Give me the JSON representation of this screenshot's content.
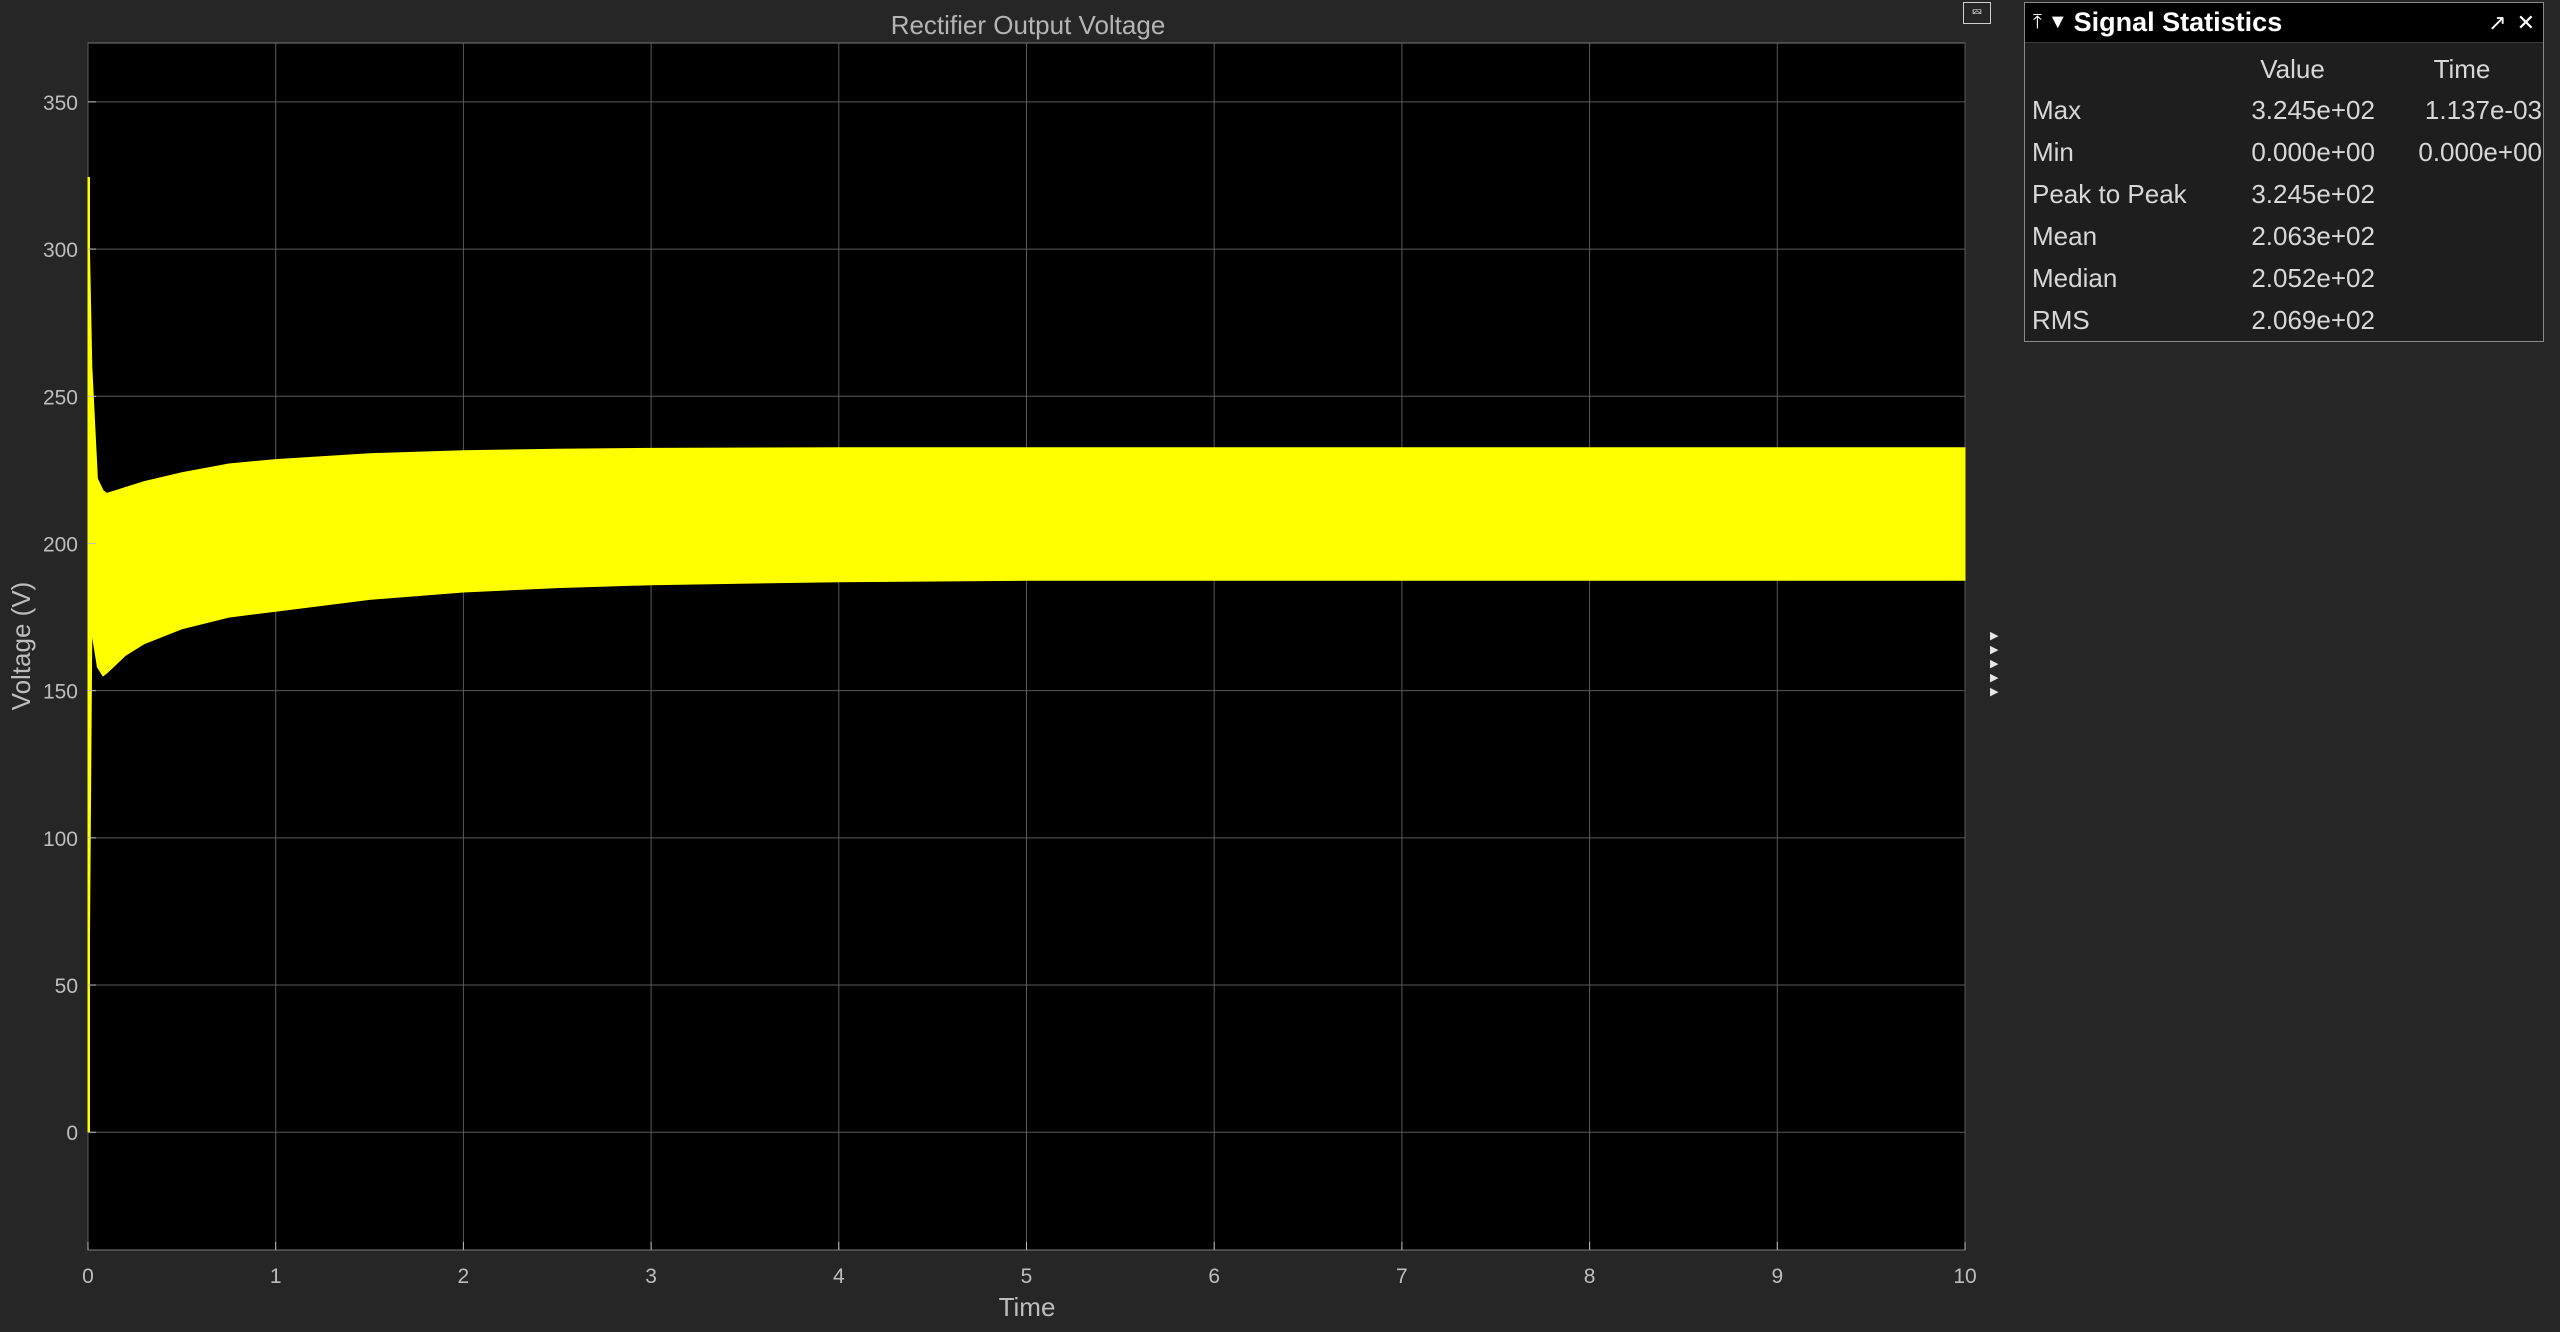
{
  "scope": {
    "colors": {
      "background": "#262626",
      "plot_background": "#000000",
      "grid": "#5a5a5a",
      "signal": "#ffff00",
      "text": "#bdbdbd"
    },
    "undock_icon": "undock-icon"
  },
  "chart_data": {
    "type": "line",
    "title": "Rectifier Output Voltage",
    "xlabel": "Time",
    "ylabel": "Voltage (V)",
    "xlim": [
      0,
      10
    ],
    "ylim": [
      -40,
      370
    ],
    "x_ticks": [
      0,
      1,
      2,
      3,
      4,
      5,
      6,
      7,
      8,
      9,
      10
    ],
    "y_ticks": [
      0,
      50,
      100,
      150,
      200,
      250,
      300,
      350
    ],
    "x_tick_labels": [
      "0",
      "1",
      "2",
      "3",
      "4",
      "5",
      "6",
      "7",
      "8",
      "9",
      "10"
    ],
    "y_tick_labels": [
      "0",
      "50",
      "100",
      "150",
      "200",
      "250",
      "300",
      "350"
    ],
    "grid": true,
    "series": [
      {
        "color": "#ffff00",
        "envelope": {
          "x": [
            0,
            0.02,
            0.05,
            0.08,
            0.1,
            0.15,
            0.2,
            0.3,
            0.5,
            0.75,
            1,
            1.5,
            2,
            2.5,
            3,
            4,
            5,
            6,
            7,
            8,
            9,
            10
          ],
          "upper": [
            324.5,
            260,
            222,
            218,
            217,
            218,
            219,
            221,
            224,
            227,
            228.5,
            230.5,
            231.5,
            232,
            232.3,
            232.5,
            232.5,
            232.5,
            232.5,
            232.5,
            232.5,
            232.5
          ],
          "lower": [
            0,
            170,
            158,
            155,
            156,
            159,
            162,
            166,
            171,
            175,
            177,
            181,
            183.5,
            185,
            186,
            187,
            187.5,
            187.5,
            187.5,
            187.5,
            187.5,
            187.5
          ]
        }
      }
    ]
  },
  "stats": {
    "title": "Signal Statistics",
    "columns": [
      "Value",
      "Time"
    ],
    "rows": [
      {
        "label": "Max",
        "value": "3.245e+02",
        "time": "1.137e-03"
      },
      {
        "label": "Min",
        "value": "0.000e+00",
        "time": "0.000e+00"
      },
      {
        "label": "Peak to Peak",
        "value": "3.245e+02",
        "time": ""
      },
      {
        "label": "Mean",
        "value": "2.063e+02",
        "time": ""
      },
      {
        "label": "Median",
        "value": "2.052e+02",
        "time": ""
      },
      {
        "label": "RMS",
        "value": "2.069e+02",
        "time": ""
      }
    ]
  }
}
